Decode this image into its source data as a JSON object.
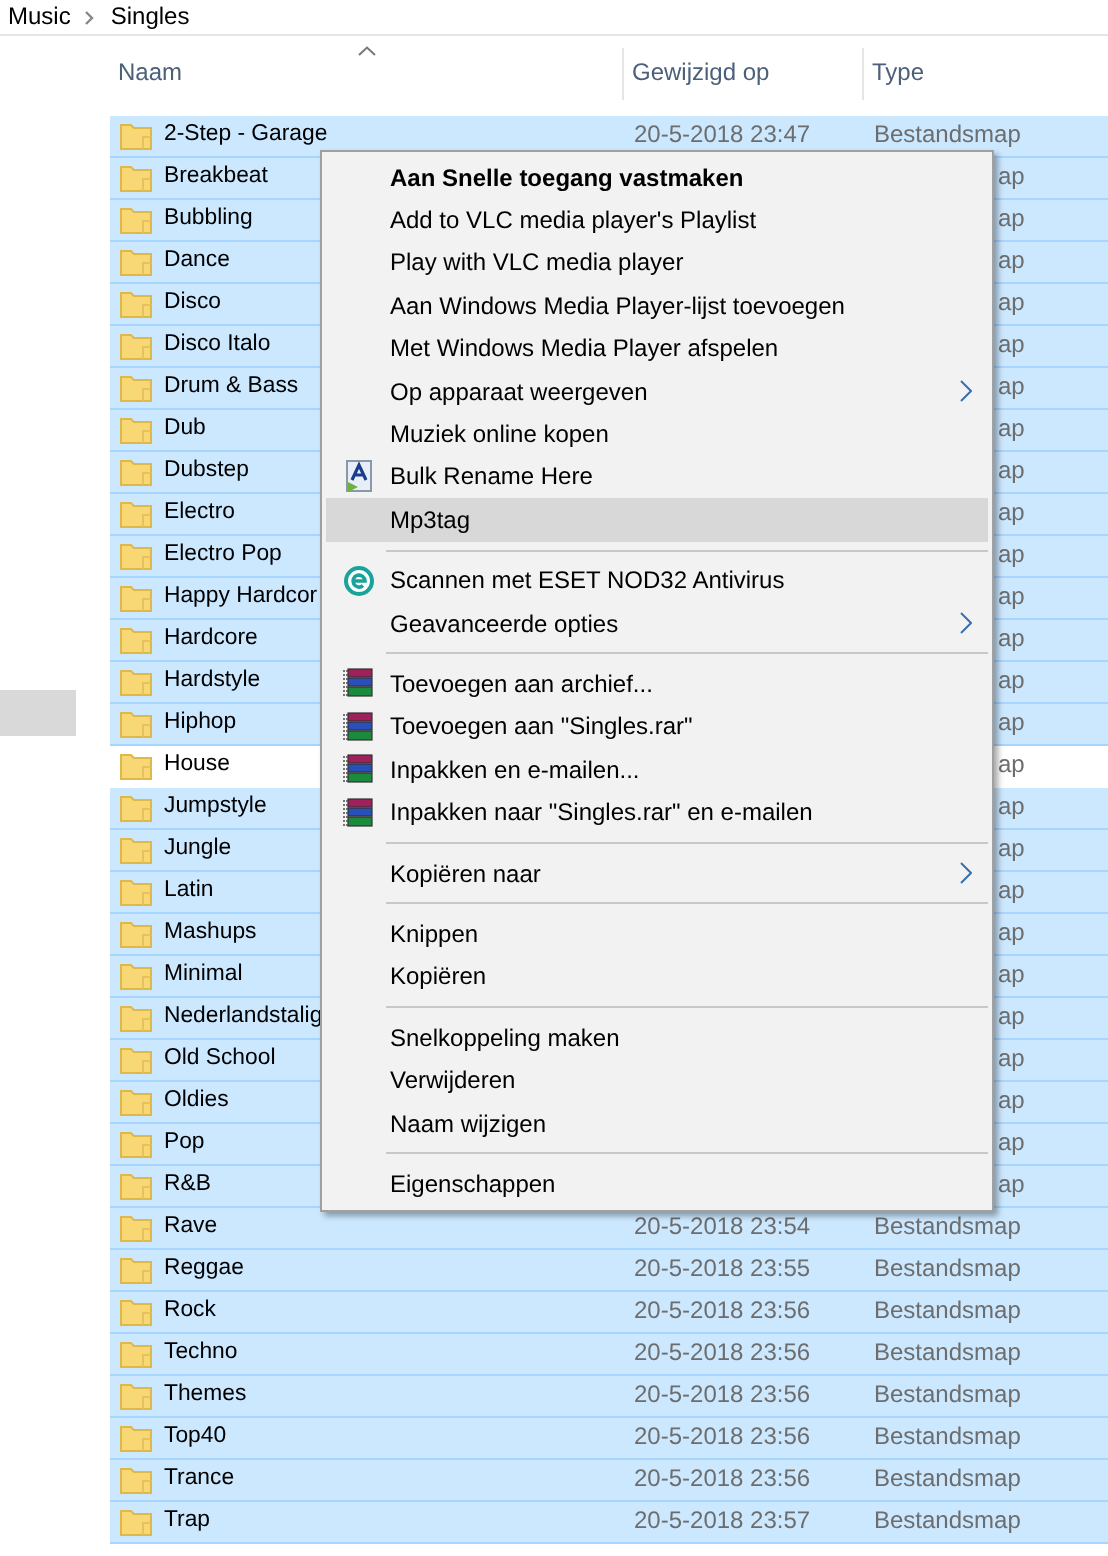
{
  "breadcrumb": [
    "Music",
    "Singles"
  ],
  "navigation_pane": {
    "items": [
      {
        "selected": true
      }
    ]
  },
  "table": {
    "columns": [
      {
        "label": "Naam",
        "sorted": true
      },
      {
        "label": "Gewijzigd op",
        "sorted": false
      },
      {
        "label": "Type",
        "sorted": false
      }
    ],
    "rows": [
      {
        "name": "2-Step - Garage",
        "modified": "20-5-2018 23:47",
        "type": "Bestandsmap",
        "selected": true
      },
      {
        "name": "Breakbeat",
        "type": "ap",
        "selected": true
      },
      {
        "name": "Bubbling",
        "type": "ap",
        "selected": true
      },
      {
        "name": "Dance",
        "type": "ap",
        "selected": true
      },
      {
        "name": "Disco",
        "type": "ap",
        "selected": true
      },
      {
        "name": "Disco Italo",
        "type": "ap",
        "selected": true
      },
      {
        "name": "Drum & Bass",
        "type": "ap",
        "selected": true
      },
      {
        "name": "Dub",
        "type": "ap",
        "selected": true
      },
      {
        "name": "Dubstep",
        "type": "ap",
        "selected": true
      },
      {
        "name": "Electro",
        "type": "ap",
        "selected": true
      },
      {
        "name": "Electro Pop",
        "type": "ap",
        "selected": true
      },
      {
        "name": "Happy Hardcor",
        "type": "ap",
        "selected": true
      },
      {
        "name": "Hardcore",
        "type": "ap",
        "selected": true
      },
      {
        "name": "Hardstyle",
        "type": "ap",
        "selected": true
      },
      {
        "name": "Hiphop",
        "type": "ap",
        "selected": true
      },
      {
        "name": "House",
        "type": "ap",
        "selected": false
      },
      {
        "name": "Jumpstyle",
        "type": "ap",
        "selected": true
      },
      {
        "name": "Jungle",
        "type": "ap",
        "selected": true
      },
      {
        "name": "Latin",
        "type": "ap",
        "selected": true
      },
      {
        "name": "Mashups",
        "type": "ap",
        "selected": true
      },
      {
        "name": "Minimal",
        "type": "ap",
        "selected": true
      },
      {
        "name": "Nederlandstalig",
        "type": "ap",
        "selected": true
      },
      {
        "name": "Old School",
        "type": "ap",
        "selected": true
      },
      {
        "name": "Oldies",
        "type": "ap",
        "selected": true
      },
      {
        "name": "Pop",
        "type": "ap",
        "selected": true
      },
      {
        "name": "R&B",
        "type": "ap",
        "selected": true
      },
      {
        "name": "Rave",
        "modified": "20-5-2018 23:54",
        "type": "Bestandsmap",
        "selected": true
      },
      {
        "name": "Reggae",
        "modified": "20-5-2018 23:55",
        "type": "Bestandsmap",
        "selected": true
      },
      {
        "name": "Rock",
        "modified": "20-5-2018 23:56",
        "type": "Bestandsmap",
        "selected": true
      },
      {
        "name": "Techno",
        "modified": "20-5-2018 23:56",
        "type": "Bestandsmap",
        "selected": true
      },
      {
        "name": "Themes",
        "modified": "20-5-2018 23:56",
        "type": "Bestandsmap",
        "selected": true
      },
      {
        "name": "Top40",
        "modified": "20-5-2018 23:56",
        "type": "Bestandsmap",
        "selected": true
      },
      {
        "name": "Trance",
        "modified": "20-5-2018 23:56",
        "type": "Bestandsmap",
        "selected": true
      },
      {
        "name": "Trap",
        "modified": "20-5-2018 23:57",
        "type": "Bestandsmap",
        "selected": true
      }
    ]
  },
  "context_menu": {
    "items": [
      {
        "kind": "item",
        "label": "Aan Snelle toegang vastmaken",
        "default": true,
        "selected": false
      },
      {
        "kind": "item",
        "label": "Add to VLC media player's Playlist",
        "default": false,
        "selected": false
      },
      {
        "kind": "item",
        "label": "Play with VLC media player",
        "default": false,
        "selected": false
      },
      {
        "kind": "item",
        "label": "Aan Windows Media Player-lijst toevoegen",
        "default": false,
        "selected": false
      },
      {
        "kind": "item",
        "label": "Met Windows Media Player afspelen",
        "default": false,
        "selected": false
      },
      {
        "kind": "item",
        "label": "Op apparaat weergeven",
        "submenu": true,
        "default": false,
        "selected": false
      },
      {
        "kind": "item",
        "label": "Muziek online kopen",
        "default": false,
        "selected": false
      },
      {
        "kind": "rename",
        "label": "Bulk Rename Here",
        "default": false,
        "selected": false
      },
      {
        "kind": "item",
        "label": "Mp3tag",
        "default": false,
        "selected": true
      },
      {
        "kind": "separator"
      },
      {
        "kind": "antivirus",
        "label": "Scannen met ESET NOD32 Antivirus",
        "default": false,
        "selected": false
      },
      {
        "kind": "item",
        "label": "Geavanceerde opties",
        "submenu": true,
        "default": false,
        "selected": false
      },
      {
        "kind": "separator"
      },
      {
        "kind": "archive",
        "label": "Toevoegen aan archief...",
        "default": false,
        "selected": false
      },
      {
        "kind": "archive",
        "label": "Toevoegen aan \"Singles.rar\"",
        "default": false,
        "selected": false
      },
      {
        "kind": "archive",
        "label": "Inpakken en e-mailen...",
        "default": false,
        "selected": false
      },
      {
        "kind": "archive",
        "label": "Inpakken naar \"Singles.rar\" en e-mailen",
        "default": false,
        "selected": false
      },
      {
        "kind": "separator"
      },
      {
        "kind": "item",
        "label": "Kopiëren naar",
        "submenu": true,
        "default": false,
        "selected": false
      },
      {
        "kind": "separator"
      },
      {
        "kind": "item",
        "label": "Knippen",
        "default": false,
        "selected": false
      },
      {
        "kind": "item",
        "label": "Kopiëren",
        "default": false,
        "selected": false
      },
      {
        "kind": "separator"
      },
      {
        "kind": "item",
        "label": "Snelkoppeling maken",
        "default": false,
        "selected": false
      },
      {
        "kind": "item",
        "label": "Verwijderen",
        "default": false,
        "selected": false
      },
      {
        "kind": "item",
        "label": "Naam wijzigen",
        "default": false,
        "selected": false
      },
      {
        "kind": "separator"
      },
      {
        "kind": "item",
        "label": "Eigenschappen",
        "default": false,
        "selected": false
      }
    ]
  }
}
